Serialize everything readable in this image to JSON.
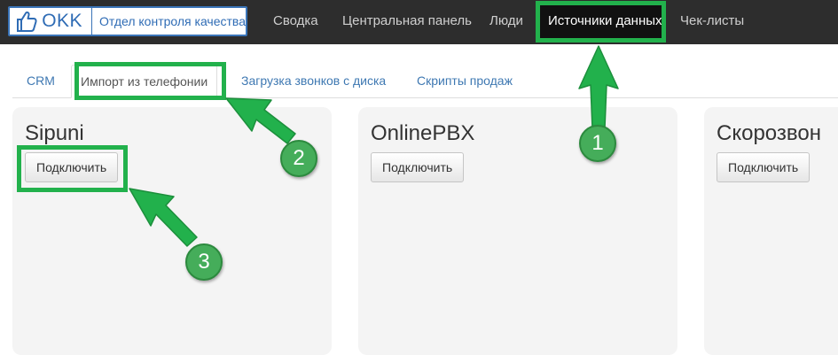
{
  "logo": {
    "abbr": "OKK",
    "department": "Отдел контроля качества"
  },
  "nav": {
    "items": [
      {
        "label": "Сводка"
      },
      {
        "label": "Центральная панель"
      },
      {
        "label": "Люди"
      },
      {
        "label": "Источники данных"
      },
      {
        "label": "Чек-листы"
      }
    ]
  },
  "tabs": [
    {
      "label": "CRM"
    },
    {
      "label": "Импорт из телефонии"
    },
    {
      "label": "Загрузка звонков с диска"
    },
    {
      "label": "Скрипты продаж"
    }
  ],
  "cards": [
    {
      "title": "Sipuni",
      "button": "Подключить"
    },
    {
      "title": "OnlinePBX",
      "button": "Подключить"
    },
    {
      "title": "Скорозвон",
      "button": "Подключить"
    }
  ],
  "annotations": {
    "step1": "1",
    "step2": "2",
    "step3": "3"
  },
  "colors": {
    "highlight": "#22b14c",
    "badge": "#45ad5a",
    "topbar": "#2d2d2d",
    "link": "#3e78b2"
  }
}
